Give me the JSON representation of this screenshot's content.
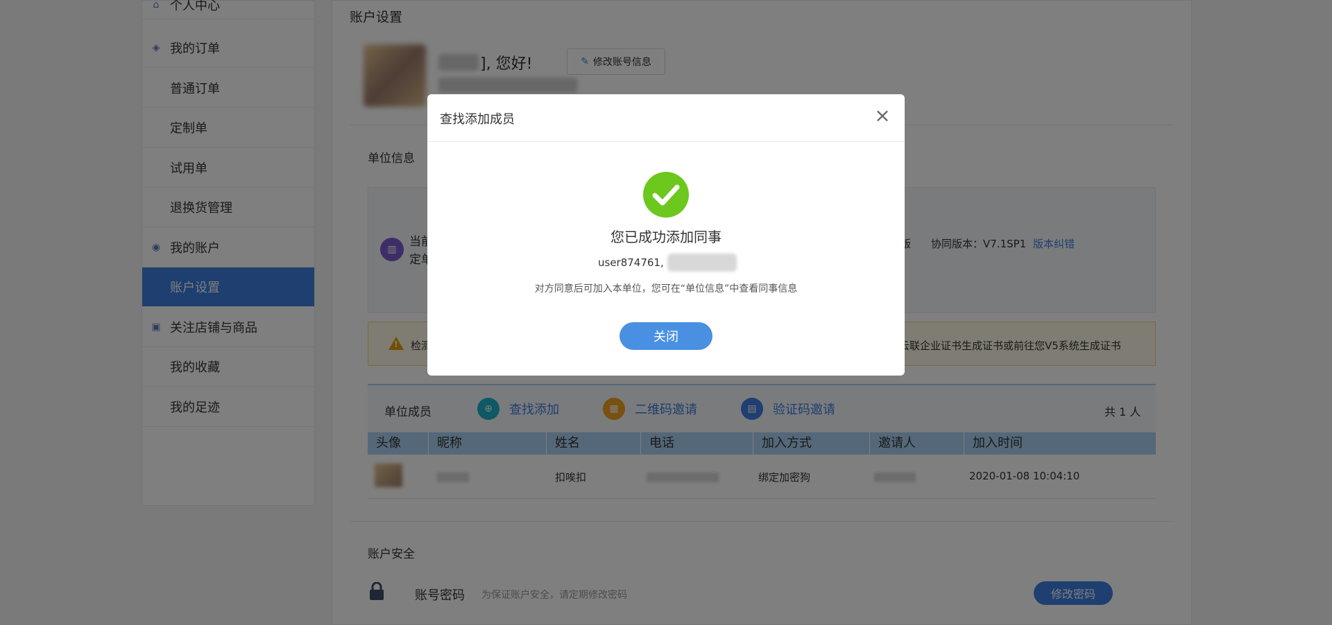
{
  "sidebar": {
    "items": [
      {
        "label": "个人中心",
        "icon": "home-icon"
      },
      {
        "label": "我的订单",
        "icon": "box-icon"
      },
      {
        "label": "普通订单"
      },
      {
        "label": "定制单"
      },
      {
        "label": "试用单"
      },
      {
        "label": "退换货管理"
      },
      {
        "label": "我的账户",
        "icon": "account-icon"
      },
      {
        "label": "账户设置"
      },
      {
        "label": "关注店铺与商品",
        "icon": "store-icon"
      },
      {
        "label": "我的收藏"
      },
      {
        "label": "我的足迹"
      }
    ]
  },
  "page": {
    "title": "账户设置",
    "greeting": "], 您好!",
    "edit_account_label": "修改账号信息"
  },
  "unit": {
    "title": "单位信息",
    "current_text_line1": "当前",
    "current_text_line2": "定单",
    "version_tail": "版",
    "collab_version": "协同版本：V7.1SP1",
    "version_fix_link": "版本纠错"
  },
  "warning": {
    "text_left": "检测",
    "text_right": "云联企业证书生成证书或前往您V5系统生成证书"
  },
  "members": {
    "label": "单位成员",
    "actions": [
      {
        "label": "查找添加",
        "color": "#1fb3c8",
        "icon": "search-add-icon"
      },
      {
        "label": "二维码邀请",
        "color": "#f0a020",
        "icon": "qrcode-icon"
      },
      {
        "label": "验证码邀请",
        "color": "#3d7fe0",
        "icon": "code-icon"
      }
    ],
    "total": "共 1 人",
    "headers": [
      "头像",
      "昵称",
      "姓名",
      "电话",
      "加入方式",
      "邀请人",
      "加入时间"
    ],
    "row": {
      "name": "扣唉扣",
      "join_method": "绑定加密狗",
      "join_time": "2020-01-08 10:04:10"
    }
  },
  "security": {
    "title": "账户安全",
    "password_label": "账号密码",
    "password_tip": "为保证账户安全，请定期修改密码",
    "change_password_label": "修改密码"
  },
  "modal": {
    "title": "查找添加成员",
    "success_text": "您已成功添加同事",
    "user_text": "user874761,",
    "note": "对方同意后可加入本单位，您可在“单位信息”中查看同事信息",
    "close_label": "关闭",
    "success_color": "#6cc81d"
  }
}
